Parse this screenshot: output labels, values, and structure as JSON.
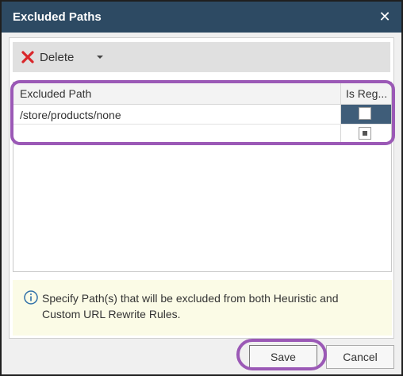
{
  "dialog": {
    "title": "Excluded Paths",
    "close_icon": "close-icon"
  },
  "toolbar": {
    "delete_label": "Delete",
    "delete_icon": "x-icon",
    "delete_icon_color": "#d9262a",
    "dropdown_icon": "caret-down-icon"
  },
  "grid": {
    "columns": [
      "Excluded Path",
      "Is Reg..."
    ],
    "rows": [
      {
        "path": "/store/products/none",
        "is_regex": false,
        "selected": true
      },
      {
        "path": "",
        "is_regex": null,
        "selected": false
      }
    ]
  },
  "info": {
    "icon": "info-icon",
    "text": "Specify Path(s) that will be excluded from both Heuristic and Custom URL Rewrite Rules."
  },
  "footer": {
    "save_label": "Save",
    "cancel_label": "Cancel"
  },
  "colors": {
    "titlebar": "#2d4a63",
    "selected_cell": "#3f5d79",
    "highlight_annotation": "#9b59b6",
    "info_background": "#fbfbe6"
  }
}
